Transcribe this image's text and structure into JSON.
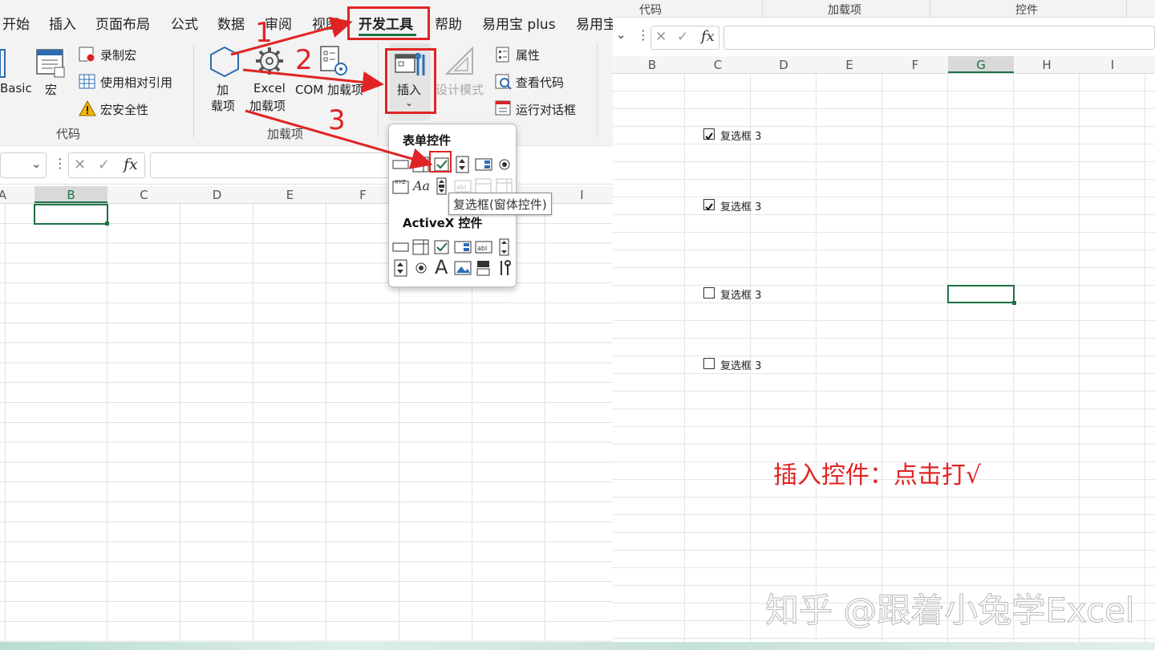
{
  "menu": {
    "tabs": [
      "开始",
      "插入",
      "页面布局",
      "公式",
      "数据",
      "审阅",
      "视图",
      "开发工具",
      "帮助",
      "易用宝 plus",
      "易用宝"
    ],
    "active_tab": "开发工具"
  },
  "ribbon": {
    "code_group": {
      "label": "代码",
      "basic_partial": "Basic",
      "macro": "宏",
      "record_macro": "录制宏",
      "relative_ref": "使用相对引用",
      "macro_security": "宏安全性"
    },
    "addins_group": {
      "label": "加载项",
      "addins_line1": "加",
      "addins_line2": "载项",
      "excel_line1": "Excel",
      "excel_line2": "加载项",
      "com_addins": "COM 加载项"
    },
    "controls_group": {
      "insert": "插入",
      "design_mode": "设计模式",
      "properties": "属性",
      "view_code": "查看代码",
      "run_dialog": "运行对话框"
    }
  },
  "formula_bar": {
    "fx": "fx"
  },
  "left_columns": [
    "A",
    "B",
    "C",
    "D",
    "E",
    "F",
    "I"
  ],
  "dropdown": {
    "form_controls_title": "表单控件",
    "activex_title": "ActiveX 控件",
    "tooltip": "复选框(窗体控件)"
  },
  "steps": [
    "1",
    "2",
    "3"
  ],
  "right": {
    "group_labels": [
      "代码",
      "加载项",
      "控件"
    ],
    "fx": "fx",
    "columns": [
      "B",
      "C",
      "D",
      "E",
      "F",
      "G",
      "H",
      "I"
    ],
    "checkboxes": [
      {
        "label": "复选框 3",
        "checked": true
      },
      {
        "label": "复选框 3",
        "checked": true
      },
      {
        "label": "复选框 3",
        "checked": false
      },
      {
        "label": "复选框 3",
        "checked": false
      }
    ],
    "annotation": "插入控件：点击打√",
    "watermark": "知乎 @跟着小兔学Excel"
  },
  "colors": {
    "accent_green": "#1e7145",
    "annotation_red": "#e02424"
  }
}
